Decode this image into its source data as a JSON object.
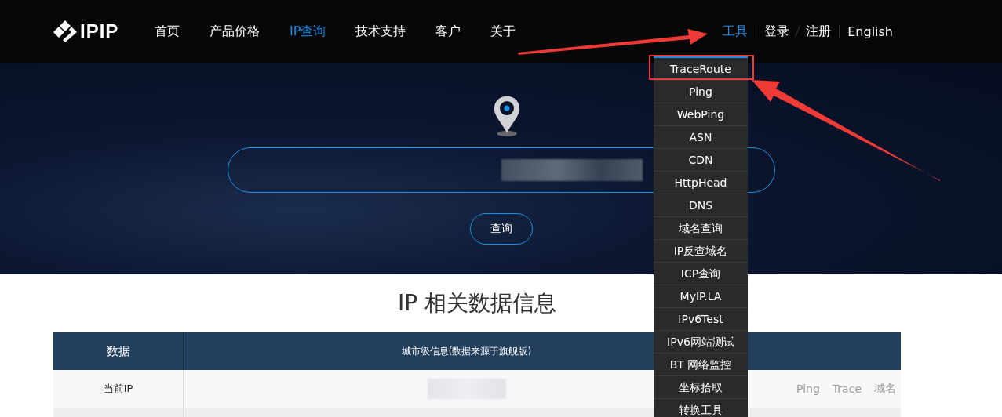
{
  "logo": {
    "text": "IPIP"
  },
  "nav": [
    {
      "label": "首页",
      "selected": false
    },
    {
      "label": "产品价格",
      "selected": false
    },
    {
      "label": "IP查询",
      "selected": true
    },
    {
      "label": "技术支持",
      "selected": false
    },
    {
      "label": "客户",
      "selected": false
    },
    {
      "label": "关于",
      "selected": false
    }
  ],
  "user_nav": [
    {
      "label": "工具",
      "selected": true
    },
    {
      "label": "登录",
      "selected": false
    },
    {
      "label": "注册",
      "selected": false
    },
    {
      "label": "English",
      "selected": false
    }
  ],
  "tools_menu": [
    {
      "label": "TraceRoute"
    },
    {
      "label": "Ping"
    },
    {
      "label": "WebPing"
    },
    {
      "label": "ASN"
    },
    {
      "label": "CDN"
    },
    {
      "label": "HttpHead"
    },
    {
      "label": "DNS"
    },
    {
      "label": "域名查询"
    },
    {
      "label": "IP反查域名"
    },
    {
      "label": "ICP查询"
    },
    {
      "label": "MyIP.LA"
    },
    {
      "label": "IPv6Test"
    },
    {
      "label": "IPv6网站测试"
    },
    {
      "label": "BT 网络监控"
    },
    {
      "label": "坐标拾取"
    },
    {
      "label": "转换工具"
    }
  ],
  "search": {
    "button": "查询"
  },
  "section_title": "IP 相关数据信息",
  "table": {
    "columns": [
      "数据",
      "城市级信息(数据来源于旗舰版)"
    ],
    "rows": [
      {
        "label": "当前IP",
        "links": [
          "Ping",
          "Trace",
          "域名"
        ]
      }
    ]
  }
}
